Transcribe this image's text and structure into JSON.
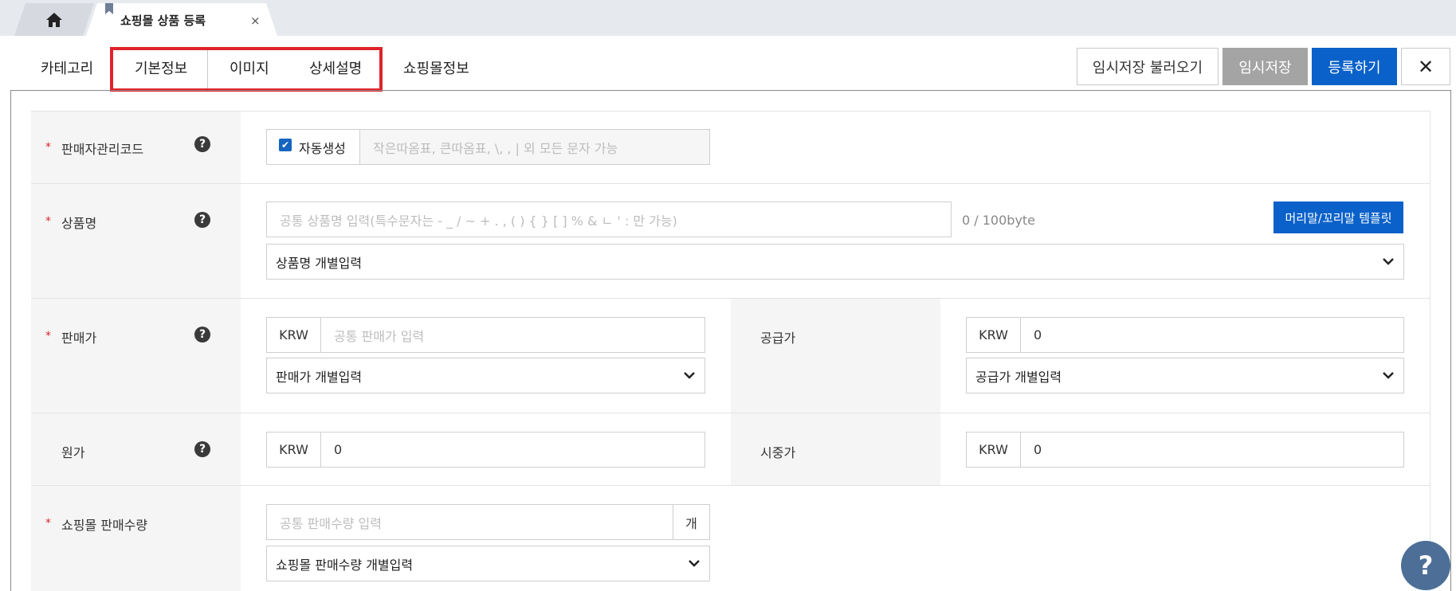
{
  "window_tabs": {
    "home_icon": "home-icon",
    "active_tab_title": "쇼핑몰 상품 등록",
    "close_glyph": "×"
  },
  "section_tabs": [
    "카테고리",
    "기본정보",
    "이미지",
    "상세설명",
    "쇼핑몰정보"
  ],
  "toolbar": {
    "load_label": "임시저장 불러오기",
    "temp_save_label": "임시저장",
    "register_label": "등록하기",
    "close_glyph": "✕"
  },
  "form": {
    "seller_code": {
      "label": "판매자관리코드",
      "required": "*",
      "auto_label": "자동생성",
      "auto_checked": true,
      "placeholder": "작은따옴표, 큰따옴표, \\,  , | 외 모든 문자 가능"
    },
    "product_name": {
      "label": "상품명",
      "required": "*",
      "placeholder": "공통 상품명 입력(특수문자는 - _ / ~ + . , ( ) { } [ ] % &  ㄴ ' : 만 가능)",
      "counter": "0 / 100byte",
      "template_button": "머리말/꼬리말 템플릿",
      "individual_select": "상품명 개별입력"
    },
    "sale_price": {
      "label": "판매가",
      "required": "*",
      "currency": "KRW",
      "placeholder": "공통 판매가 입력",
      "individual_select": "판매가 개별입력"
    },
    "supply_price": {
      "label": "공급가",
      "currency": "KRW",
      "value": "0",
      "individual_select": "공급가 개별입력"
    },
    "cost_price": {
      "label": "원가",
      "currency": "KRW",
      "value": "0"
    },
    "market_price": {
      "label": "시중가",
      "currency": "KRW",
      "value": "0"
    },
    "sale_quantity": {
      "label": "쇼핑몰 판매수량",
      "required": "*",
      "placeholder": "공통 판매수량 입력",
      "unit": "개",
      "individual_select": "쇼핑몰 판매수량 개별입력"
    }
  },
  "help_glyph": "?",
  "fab_glyph": "?",
  "colors": {
    "accent": "#0a61c9",
    "required": "#d7262e",
    "highlight_box": "#e0232b",
    "temp_save_bg": "#a4a4a4",
    "fab_bg": "#4d6f97"
  }
}
